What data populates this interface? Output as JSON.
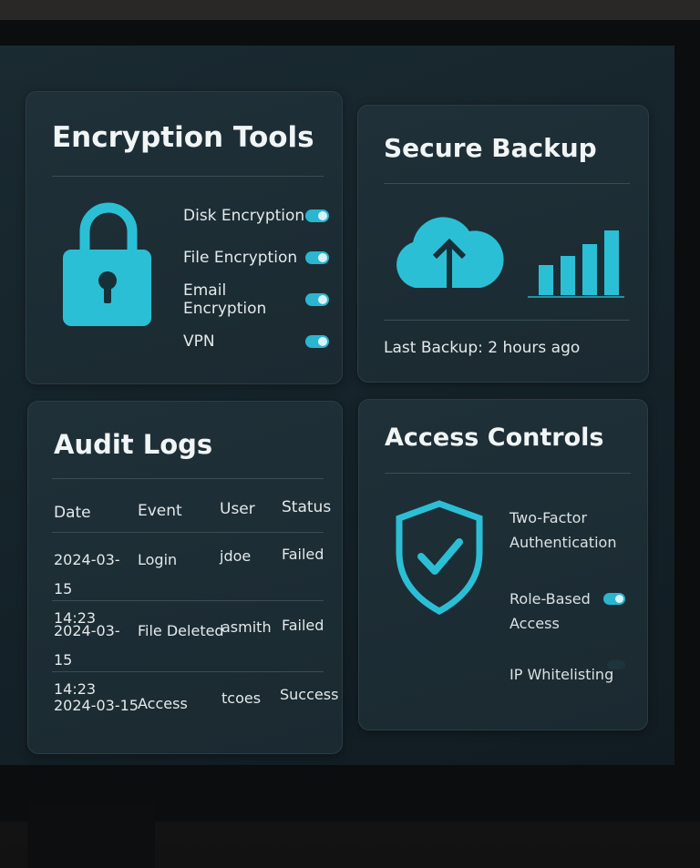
{
  "encryption": {
    "title": "Encryption Tools",
    "icon": "lock-icon",
    "items": [
      {
        "label": "Disk Encryption",
        "enabled": true
      },
      {
        "label": "File Encryption",
        "enabled": true
      },
      {
        "label": "Email Encryption",
        "enabled": true
      },
      {
        "label": "VPN",
        "enabled": true
      }
    ]
  },
  "backup": {
    "title": "Secure Backup",
    "icon": "cloud-upload-icon",
    "chart_icon": "bar-chart-icon",
    "status": "Last Backup: 2 hours ago"
  },
  "audit": {
    "title": "Audit Logs",
    "columns": [
      "Date",
      "Event",
      "User",
      "Status"
    ],
    "rows": [
      {
        "date": "2024-03-15",
        "time": "14:23",
        "event": "Login",
        "user": "jdoe",
        "status": "Failed"
      },
      {
        "date": "2024-03-15",
        "time": "14:23",
        "event": "File Deleted",
        "user": "asmith",
        "status": "Failed"
      },
      {
        "date": "2024-03-15",
        "time": "",
        "event": "Access",
        "user": "tcoes",
        "status": "Success"
      }
    ]
  },
  "access": {
    "title": "Access Controls",
    "icon": "shield-check-icon",
    "items": [
      {
        "label": "Two-Factor Authentication",
        "enabled": null
      },
      {
        "label": "Role-Based Access",
        "enabled": true
      },
      {
        "label": "IP Whitelisting",
        "enabled": false
      }
    ]
  },
  "colors": {
    "accent": "#2bb5cf",
    "card_bg": "#1d2d34",
    "text": "#e3e9eb"
  }
}
